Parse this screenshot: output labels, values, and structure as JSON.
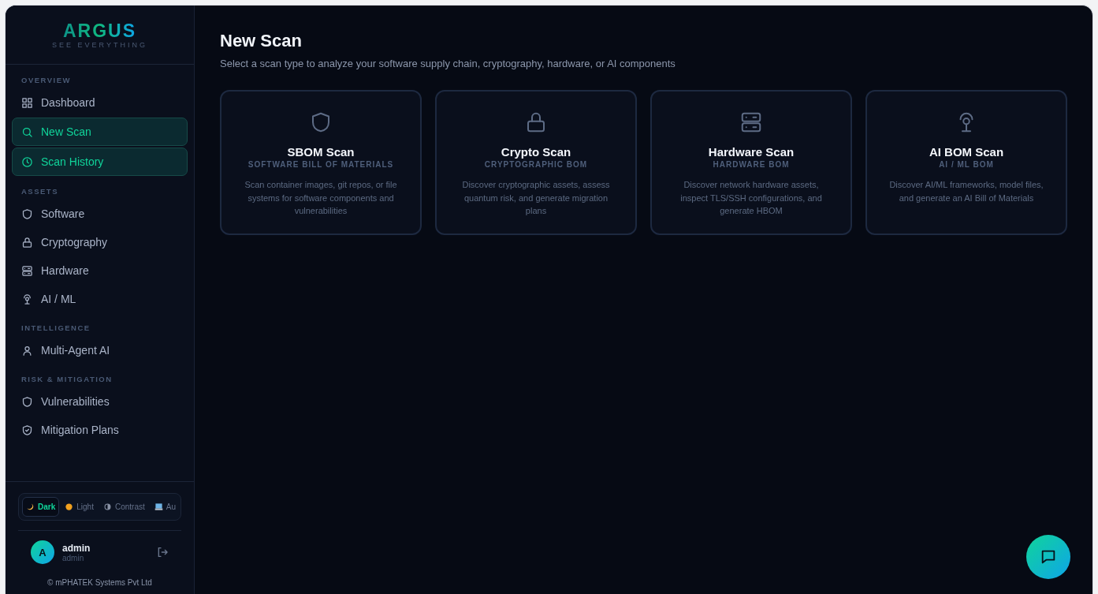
{
  "brand": {
    "name": "ARGUS",
    "tagline": "SEE EVERYTHING"
  },
  "sidebar": {
    "sections": [
      {
        "title": "OVERVIEW",
        "items": [
          {
            "label": "Dashboard",
            "selected": false
          },
          {
            "label": "New Scan",
            "selected": true
          },
          {
            "label": "Scan History",
            "selected": true
          }
        ]
      },
      {
        "title": "ASSETS",
        "items": [
          {
            "label": "Software",
            "selected": false
          },
          {
            "label": "Cryptography",
            "selected": false
          },
          {
            "label": "Hardware",
            "selected": false
          },
          {
            "label": "AI / ML",
            "selected": false
          }
        ]
      },
      {
        "title": "INTELLIGENCE",
        "items": [
          {
            "label": "Multi-Agent AI",
            "selected": false
          }
        ]
      },
      {
        "title": "RISK & MITIGATION",
        "items": [
          {
            "label": "Vulnerabilities",
            "selected": false
          },
          {
            "label": "Mitigation Plans",
            "selected": false
          }
        ]
      }
    ]
  },
  "theme_switcher": [
    {
      "label": "Dark",
      "selected": true
    },
    {
      "label": "Light",
      "selected": false
    },
    {
      "label": "Contrast",
      "selected": false
    },
    {
      "label": "Au",
      "selected": false
    }
  ],
  "user": {
    "avatar": "A",
    "name": "admin",
    "role": "admin"
  },
  "footer": "© mPHATEK Systems Pvt Ltd",
  "page": {
    "title": "New Scan",
    "subtitle": "Select a scan type to analyze your software supply chain, cryptography, hardware, or AI components"
  },
  "scan_types": [
    {
      "title": "SBOM Scan",
      "subtitle": "SOFTWARE BILL OF MATERIALS",
      "description": "Scan container images, git repos, or file systems for software components and vulnerabilities"
    },
    {
      "title": "Crypto Scan",
      "subtitle": "CRYPTOGRAPHIC BOM",
      "description": "Discover cryptographic assets, assess quantum risk, and generate migration plans"
    },
    {
      "title": "Hardware Scan",
      "subtitle": "HARDWARE BOM",
      "description": "Discover network hardware assets, inspect TLS/SSH configurations, and generate HBOM"
    },
    {
      "title": "AI BOM Scan",
      "subtitle": "AI / ML BOM",
      "description": "Discover AI/ML frameworks, model files, and generate an AI Bill of Materials"
    }
  ]
}
